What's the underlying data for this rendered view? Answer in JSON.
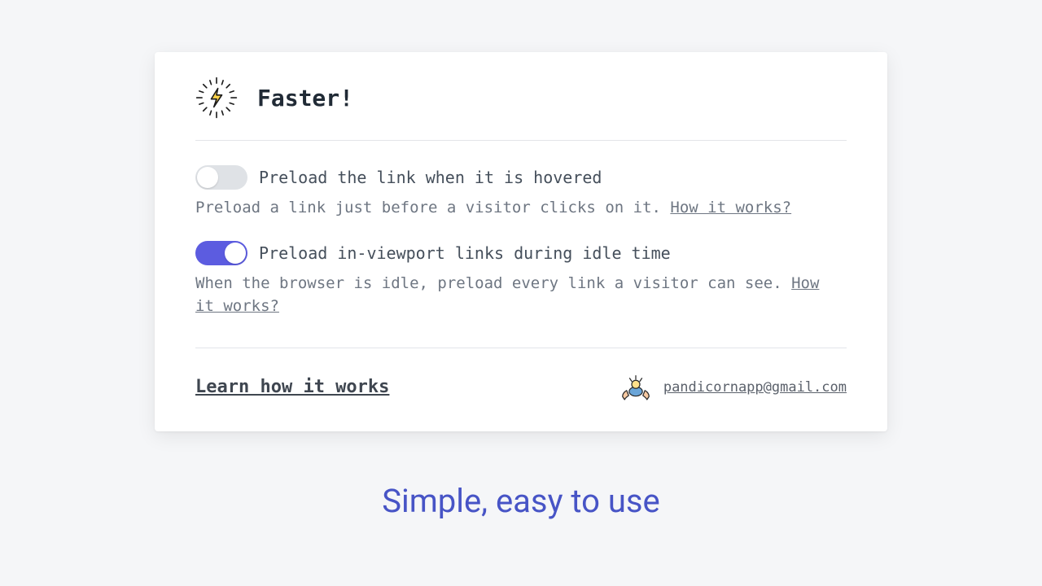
{
  "header": {
    "title": "Faster!"
  },
  "options": [
    {
      "enabled": false,
      "title": "Preload the link when it is hovered",
      "description": "Preload a link just before a visitor clicks on it. ",
      "link_label": "How it works?"
    },
    {
      "enabled": true,
      "title": "Preload in-viewport links during idle time",
      "description": "When the browser is idle, preload every link a visitor can see. ",
      "link_label": "How it works?"
    }
  ],
  "footer": {
    "learn_label": "Learn how it works",
    "email": "pandicornapp@gmail.com"
  },
  "tagline": "Simple, easy to use",
  "colors": {
    "accent": "#5c5ce0",
    "tagline": "#4754c6"
  }
}
